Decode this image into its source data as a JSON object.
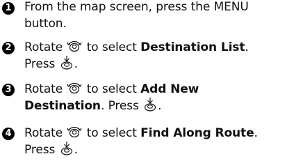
{
  "steps": [
    {
      "number": "1",
      "line1": "From the map screen, press the MENU",
      "line2": "button."
    },
    {
      "number": "2",
      "rotate": "Rotate",
      "to_select": "to select",
      "target": "Destination List",
      "period": ".",
      "press": "Press",
      "end": "."
    },
    {
      "number": "3",
      "rotate": "Rotate",
      "to_select": "to select",
      "target1": "Add New",
      "target2": "Destination",
      "period": ".",
      "press": "Press",
      "end": "."
    },
    {
      "number": "4",
      "rotate": "Rotate",
      "to_select": "to select",
      "target": "Find Along Route",
      "period": ".",
      "press": "Press",
      "end": "."
    }
  ],
  "icons": {
    "rotate": "rotate-dial-icon",
    "press": "press-knob-icon"
  }
}
